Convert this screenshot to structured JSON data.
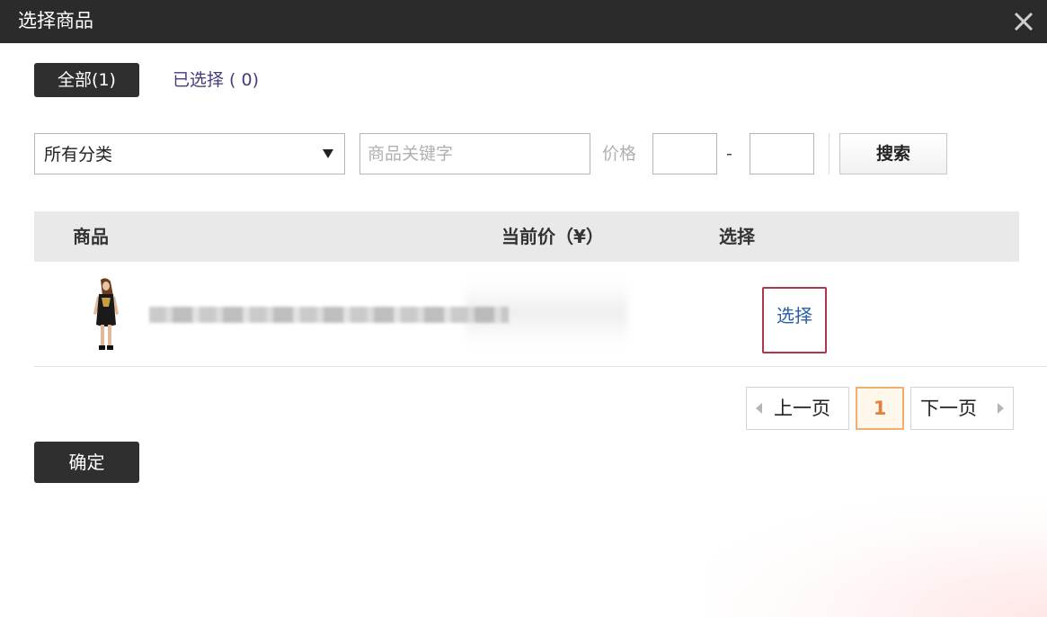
{
  "dialog": {
    "title": "选择商品",
    "close_icon": "close-icon"
  },
  "tabs": {
    "all_label": "全部(1)",
    "selected_label": "已选择 ( 0)"
  },
  "filters": {
    "category_value": "所有分类",
    "category_arrow_icon": "triangle-down-icon",
    "keyword_placeholder": "商品关键字",
    "price_label": "价格",
    "price_min": "",
    "price_max": "",
    "price_separator": "-",
    "search_label": "搜索"
  },
  "table": {
    "headers": {
      "product": "商品",
      "current_price": "当前价（¥）",
      "select": "选择"
    },
    "rows": [
      {
        "thumbnail": "product-thumbnail",
        "name": "",
        "price": "",
        "select_label": "选择"
      }
    ]
  },
  "pagination": {
    "prev_label": "上一页",
    "current_page": "1",
    "next_label": "下一页"
  },
  "footer": {
    "confirm_label": "确定"
  },
  "colors": {
    "titlebar": "#2b2b2b",
    "primary_button": "#2f2f2f",
    "select_link_border": "#b0374a",
    "select_link_text": "#2a5fa8",
    "current_page": "#e0823a"
  }
}
